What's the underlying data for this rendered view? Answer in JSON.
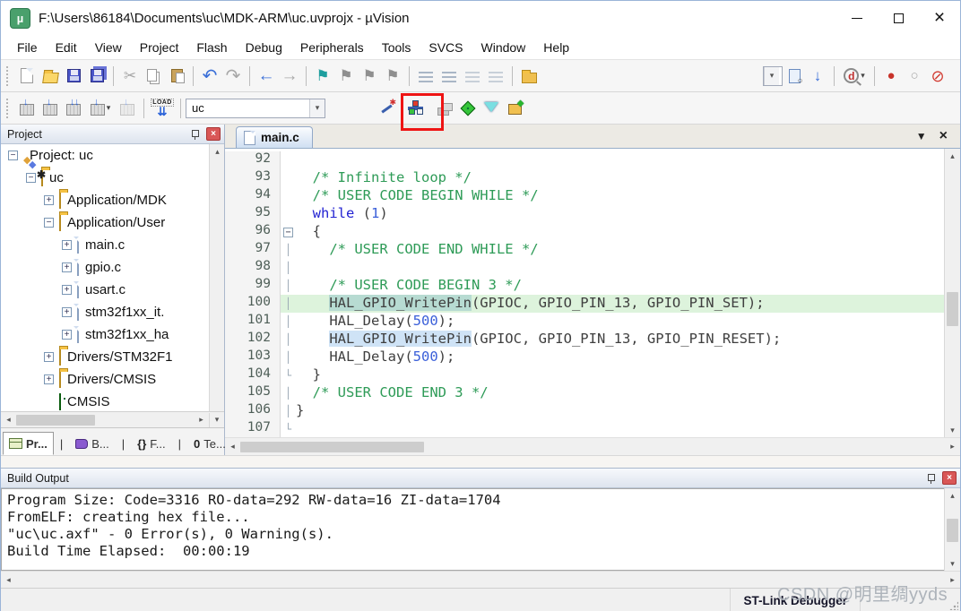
{
  "window": {
    "title": "F:\\Users\\86184\\Documents\\uc\\MDK-ARM\\uc.uvprojx - µVision",
    "logo_text": "µ"
  },
  "menu": {
    "items": [
      "File",
      "Edit",
      "View",
      "Project",
      "Flash",
      "Debug",
      "Peripherals",
      "Tools",
      "SVCS",
      "Window",
      "Help"
    ]
  },
  "icons": {
    "cut": "✂",
    "undo": "↶",
    "redo": "↷",
    "back": "←",
    "forward": "→",
    "flag": "⚑",
    "breakpoint": "●",
    "breakpoint_empty": "○",
    "breakpoint_disable": "⊘",
    "up": "▴",
    "down": "▾",
    "left": "◂",
    "right": "▸",
    "close": "×",
    "dropdown": "▼"
  },
  "toolbar2": {
    "load_label": "LOAD",
    "target_value": "uc"
  },
  "project_panel": {
    "title": "Project",
    "tree": [
      {
        "label": "Project: uc",
        "lv": 0,
        "exp": "-",
        "icon": "target"
      },
      {
        "label": "uc",
        "lv": 1,
        "exp": "-",
        "icon": "target-folder"
      },
      {
        "label": "Application/MDK",
        "lv": 2,
        "exp": "+",
        "icon": "folder"
      },
      {
        "label": "Application/User",
        "lv": 2,
        "exp": "-",
        "icon": "folder-open"
      },
      {
        "label": "main.c",
        "lv": 3,
        "exp": "+",
        "icon": "file"
      },
      {
        "label": "gpio.c",
        "lv": 3,
        "exp": "+",
        "icon": "file"
      },
      {
        "label": "usart.c",
        "lv": 3,
        "exp": "+",
        "icon": "file"
      },
      {
        "label": "stm32f1xx_it.",
        "lv": 3,
        "exp": "+",
        "icon": "file"
      },
      {
        "label": "stm32f1xx_ha",
        "lv": 3,
        "exp": "+",
        "icon": "file"
      },
      {
        "label": "Drivers/STM32F1",
        "lv": 2,
        "exp": "+",
        "icon": "folder"
      },
      {
        "label": "Drivers/CMSIS",
        "lv": 2,
        "exp": "+",
        "icon": "folder"
      },
      {
        "label": "CMSIS",
        "lv": 2,
        "exp": "",
        "icon": "diamond"
      }
    ],
    "tabs": [
      {
        "label": "Pr...",
        "icon": "project-table",
        "glyph": ""
      },
      {
        "label": "B...",
        "icon": "book",
        "glyph": ""
      },
      {
        "label": "F...",
        "icon": "glyph",
        "glyph": "{}"
      },
      {
        "label": "Te...",
        "icon": "glyph",
        "glyph": "0"
      }
    ]
  },
  "editor": {
    "tab": "main.c",
    "lines": [
      {
        "n": "92",
        "f": "",
        "bg": "",
        "s": []
      },
      {
        "n": "93",
        "f": "",
        "bg": "",
        "s": [
          [
            "p",
            "  "
          ],
          [
            "c",
            "/* Infinite loop */"
          ]
        ]
      },
      {
        "n": "94",
        "f": "",
        "bg": "",
        "s": [
          [
            "p",
            "  "
          ],
          [
            "c",
            "/* USER CODE BEGIN WHILE */"
          ]
        ]
      },
      {
        "n": "95",
        "f": "",
        "bg": "",
        "s": [
          [
            "p",
            "  "
          ],
          [
            "k",
            "while"
          ],
          [
            "p",
            " ("
          ],
          [
            "n",
            "1"
          ],
          [
            "p",
            ")"
          ]
        ]
      },
      {
        "n": "96",
        "f": "m",
        "bg": "",
        "s": [
          [
            "p",
            "  {"
          ]
        ]
      },
      {
        "n": "97",
        "f": "l",
        "bg": "",
        "s": [
          [
            "p",
            "    "
          ],
          [
            "c",
            "/* USER CODE END WHILE */"
          ]
        ]
      },
      {
        "n": "98",
        "f": "l",
        "bg": "",
        "s": []
      },
      {
        "n": "99",
        "f": "l",
        "bg": "",
        "s": [
          [
            "p",
            "    "
          ],
          [
            "c",
            "/* USER CODE BEGIN 3 */"
          ]
        ]
      },
      {
        "n": "100",
        "f": "l",
        "bg": "g",
        "s": [
          [
            "p",
            "    "
          ],
          [
            "hg",
            "HAL_GPIO_WritePin"
          ],
          [
            "p",
            "(GPIOC, GPIO_PIN_13, GPIO_PIN_SET);"
          ]
        ]
      },
      {
        "n": "101",
        "f": "l",
        "bg": "",
        "s": [
          [
            "p",
            "    "
          ],
          [
            "p",
            "HAL_Delay("
          ],
          [
            "n",
            "500"
          ],
          [
            "p",
            ");"
          ]
        ]
      },
      {
        "n": "102",
        "f": "l",
        "bg": "",
        "s": [
          [
            "p",
            "    "
          ],
          [
            "hb",
            "HAL_GPIO_WritePin"
          ],
          [
            "p",
            "(GPIOC, GPIO_PIN_13, GPIO_PIN_RESET);"
          ]
        ]
      },
      {
        "n": "103",
        "f": "l",
        "bg": "",
        "s": [
          [
            "p",
            "    "
          ],
          [
            "p",
            "HAL_Delay("
          ],
          [
            "n",
            "500"
          ],
          [
            "p",
            ");"
          ]
        ]
      },
      {
        "n": "104",
        "f": "e",
        "bg": "",
        "s": [
          [
            "p",
            "  }"
          ]
        ]
      },
      {
        "n": "105",
        "f": "l",
        "bg": "",
        "s": [
          [
            "p",
            "  "
          ],
          [
            "c",
            "/* USER CODE END 3 */"
          ]
        ]
      },
      {
        "n": "106",
        "f": "l",
        "bg": "",
        "s": [
          [
            "p",
            "}"
          ]
        ]
      },
      {
        "n": "107",
        "f": "e",
        "bg": "",
        "s": []
      }
    ]
  },
  "build_output": {
    "title": "Build Output",
    "lines": [
      "Program Size: Code=3316 RO-data=292 RW-data=16 ZI-data=1704",
      "FromELF: creating hex file...",
      "\"uc\\uc.axf\" - 0 Error(s), 0 Warning(s).",
      "Build Time Elapsed:  00:00:19"
    ]
  },
  "status": {
    "debugger_label": "ST-Link Debugger",
    "watermark": "CSDN @明里绸yyds"
  }
}
